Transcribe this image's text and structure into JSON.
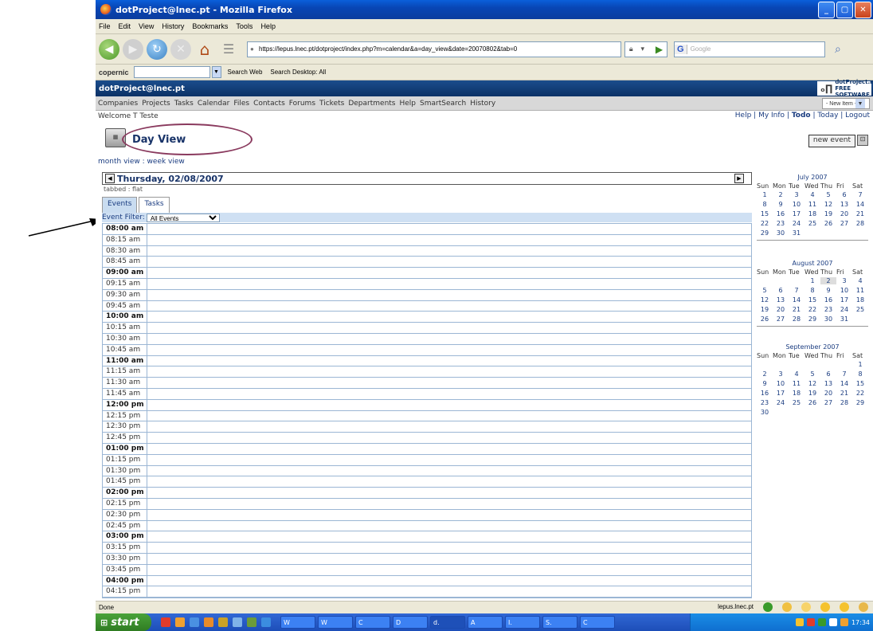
{
  "browser": {
    "window_title": "dotProject@lnec.pt - Mozilla Firefox",
    "menu": [
      "File",
      "Edit",
      "View",
      "History",
      "Bookmarks",
      "Tools",
      "Help"
    ],
    "url": "https://lepus.lnec.pt/dotproject/index.php?m=calendar&a=day_view&date=20070802&tab=0",
    "search_engine_placeholder": "Google",
    "copernic": {
      "logo": "copernic",
      "search_web": "Search Web",
      "search_desktop": "Search Desktop: All"
    },
    "status": "Done",
    "status_host": "lepus.lnec.pt"
  },
  "app": {
    "header_title": "dotProject@lnec.pt",
    "logo_text": "dotProject.net",
    "logo_sub": "FREE SOFTWARE",
    "modules": [
      "Companies",
      "Projects",
      "Tasks",
      "Calendar",
      "Files",
      "Contacts",
      "Forums",
      "Tickets",
      "Departments",
      "Help",
      "SmartSearch",
      "History"
    ],
    "new_item": "- New Item -",
    "welcome": "Welcome T Teste",
    "links": {
      "help": "Help",
      "myinfo": "My Info",
      "todo": "Todo",
      "today": "Today",
      "logout": "Logout"
    }
  },
  "page": {
    "title": "Day View",
    "new_event": "new event",
    "view_links": "month view : week view",
    "date": "Thursday, 02/08/2007",
    "tab_mode": "tabbed : flat",
    "tabs": [
      "Events",
      "Tasks"
    ],
    "filter_label": "Event Filter:",
    "filter_value": "All Events",
    "slots": [
      "08:00 am",
      "08:15 am",
      "08:30 am",
      "08:45 am",
      "09:00 am",
      "09:15 am",
      "09:30 am",
      "09:45 am",
      "10:00 am",
      "10:15 am",
      "10:30 am",
      "10:45 am",
      "11:00 am",
      "11:15 am",
      "11:30 am",
      "11:45 am",
      "12:00 pm",
      "12:15 pm",
      "12:30 pm",
      "12:45 pm",
      "01:00 pm",
      "01:15 pm",
      "01:30 pm",
      "01:45 pm",
      "02:00 pm",
      "02:15 pm",
      "02:30 pm",
      "02:45 pm",
      "03:00 pm",
      "03:15 pm",
      "03:30 pm",
      "03:45 pm",
      "04:00 pm",
      "04:15 pm"
    ]
  },
  "mini_calendars": [
    {
      "title": "July 2007",
      "lead_blanks": 0,
      "days": 31,
      "selected": 0
    },
    {
      "title": "August 2007",
      "lead_blanks": 3,
      "days": 31,
      "selected": 2
    },
    {
      "title": "September 2007",
      "lead_blanks": 6,
      "days": 30,
      "selected": 0
    }
  ],
  "weekdays": [
    "Sun",
    "Mon",
    "Tue",
    "Wed",
    "Thu",
    "Fri",
    "Sat"
  ],
  "taskbar": {
    "start": "start",
    "tasks": [
      "W",
      "W",
      "C",
      "D",
      "d.",
      "A",
      "I.",
      "S.",
      "C"
    ],
    "clock": "17:34"
  }
}
